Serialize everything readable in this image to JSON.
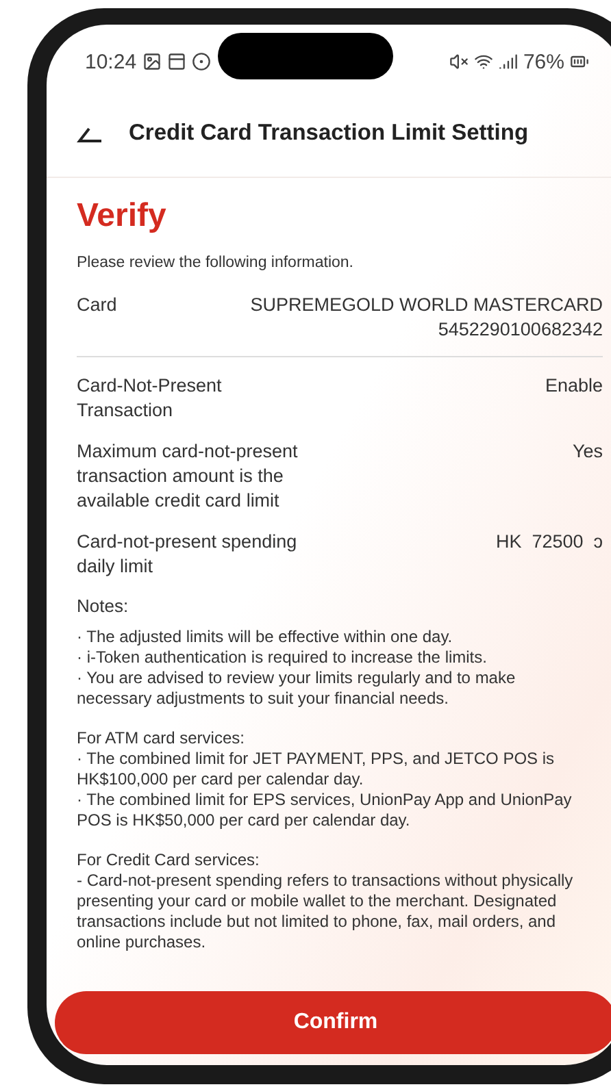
{
  "status_bar": {
    "time": "10:24",
    "battery": "76%"
  },
  "header": {
    "title": "Credit Card Transaction Limit Setting"
  },
  "page": {
    "title": "Verify",
    "subtitle": "Please review the following information."
  },
  "details": [
    {
      "label": "Card",
      "value": [
        "SUPREMEGOLD WORLD MASTERCARD",
        "5452290100682342"
      ],
      "divider": true
    },
    {
      "label": "Card-Not-Present Transaction",
      "value": [
        "Enable"
      ],
      "divider": false
    },
    {
      "label": "Maximum card-not-present transaction amount is the available credit card limit",
      "value": [
        "Yes"
      ],
      "divider": false
    },
    {
      "label": "Card-not-present spending daily limit",
      "value": [
        "HK  72500  ɔ"
      ],
      "divider": false
    }
  ],
  "notes": {
    "title": "Notes:",
    "sections": [
      {
        "items": [
          "· The adjusted limits will be effective within one day.",
          "· i-Token authentication is required to increase the limits.",
          "· You are advised to review your limits regularly and to make necessary adjustments to suit your financial needs."
        ]
      },
      {
        "heading": "For ATM card services:",
        "items": [
          "· The combined limit for JET PAYMENT, PPS, and JETCO POS is HK$100,000 per card per calendar day.",
          "· The combined limit for EPS services, UnionPay App and UnionPay POS is HK$50,000 per card per calendar day."
        ]
      },
      {
        "heading": "For Credit Card services:",
        "items": [
          "- Card-not-present spending refers to transactions without physically presenting your card or mobile wallet to the merchant. Designated transactions include but not limited to phone, fax, mail orders, and online purchases."
        ]
      }
    ]
  },
  "confirm_button": "Confirm"
}
